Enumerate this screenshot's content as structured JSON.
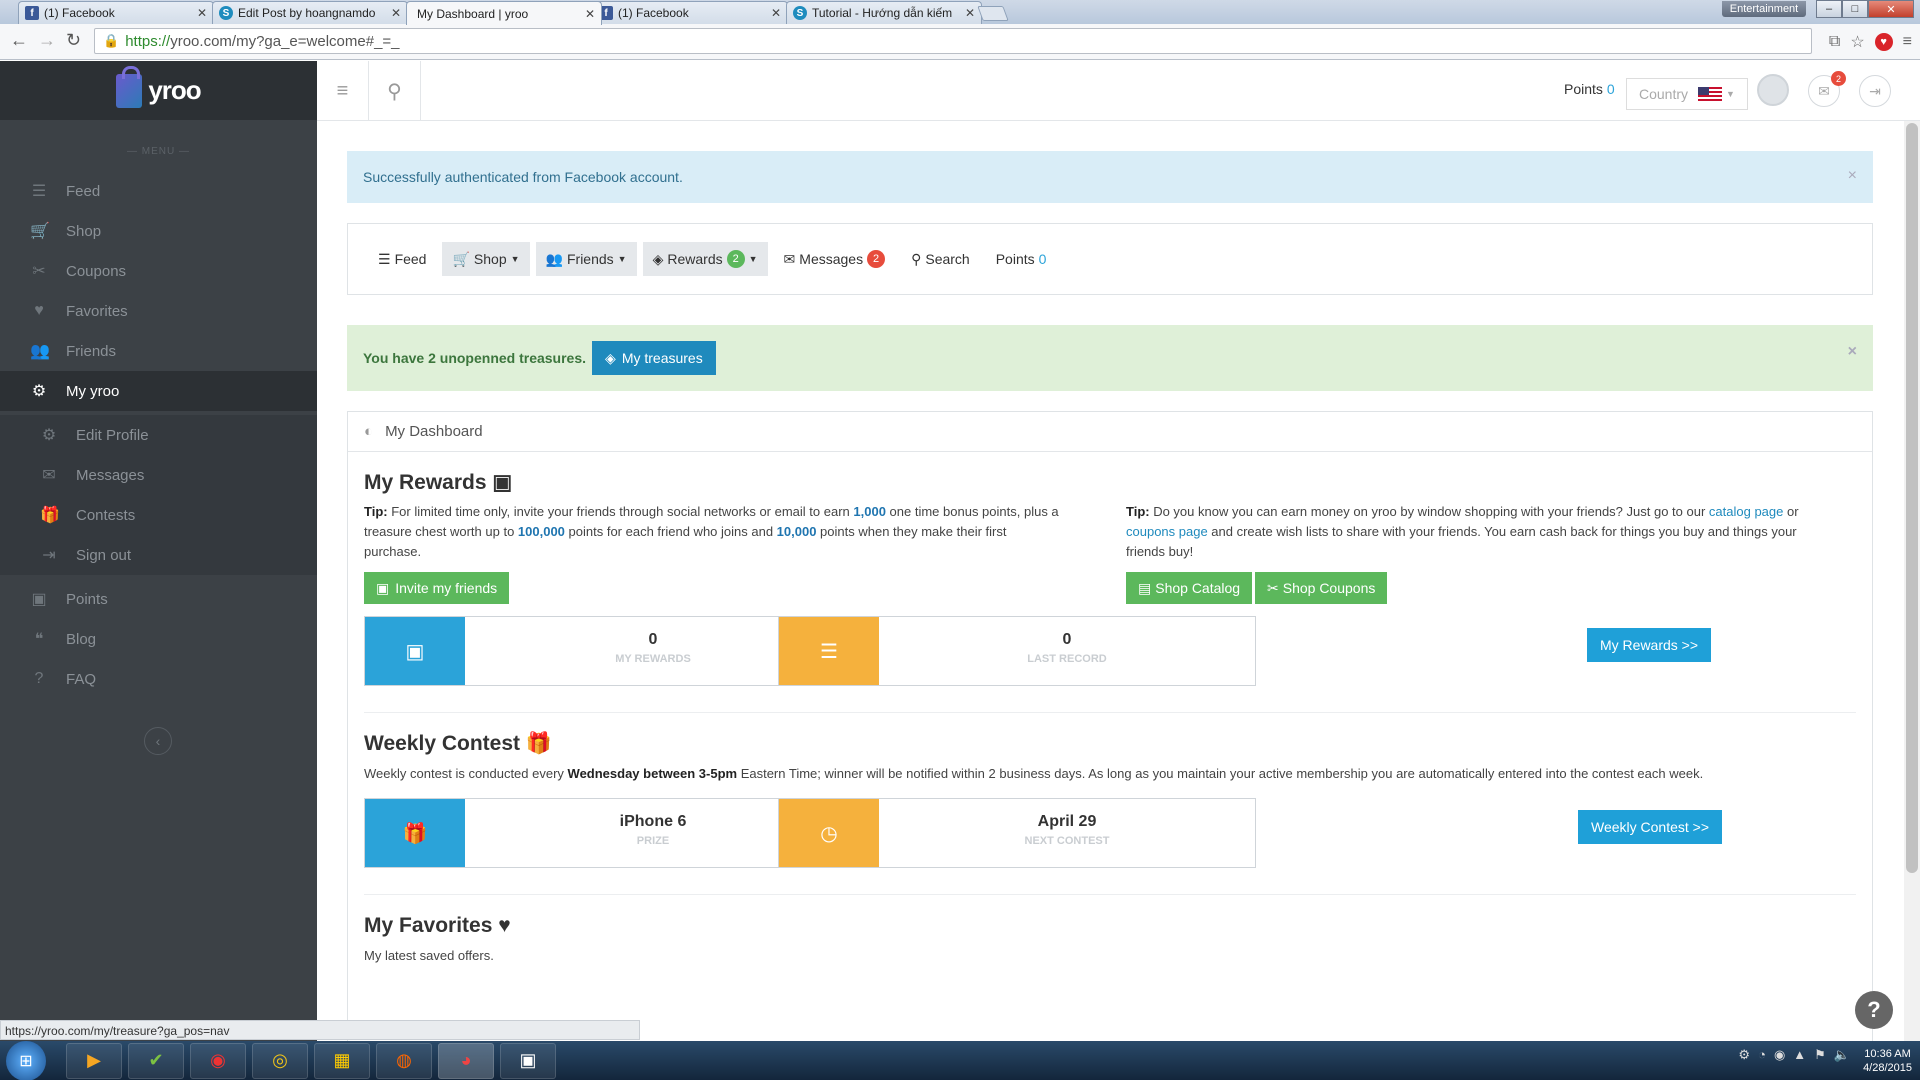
{
  "browser": {
    "tabs": [
      {
        "title": "(1) Facebook",
        "icon": "facebook-icon"
      },
      {
        "title": "Edit Post by hoangnamdo",
        "icon": "page-icon"
      },
      {
        "title": "My Dashboard | yroo",
        "icon": "none"
      },
      {
        "title": "(1) Facebook",
        "icon": "facebook-icon"
      },
      {
        "title": "Tutorial - Hướng dẫn kiếm",
        "icon": "page-icon"
      }
    ],
    "profile_badge": "Entertainment",
    "url_scheme": "https://",
    "url_rest": "yroo.com/my?ga_e=welcome#_=_",
    "status_url": "https://yroo.com/my/treasure?ga_pos=nav"
  },
  "sidebar": {
    "brand": "yroo",
    "menu_caption": "— MENU —",
    "items": [
      {
        "label": "Feed",
        "icon": "list-icon"
      },
      {
        "label": "Shop",
        "icon": "cart-icon"
      },
      {
        "label": "Coupons",
        "icon": "scissors-icon"
      },
      {
        "label": "Favorites",
        "icon": "heart-icon"
      },
      {
        "label": "Friends",
        "icon": "users-icon"
      },
      {
        "label": "My yroo",
        "icon": "gears-icon"
      }
    ],
    "sub_items": [
      {
        "label": "Edit Profile",
        "icon": "gears-icon"
      },
      {
        "label": "Messages",
        "icon": "envelope-icon"
      },
      {
        "label": "Contests",
        "icon": "gift-icon"
      },
      {
        "label": "Sign out",
        "icon": "signout-icon"
      }
    ],
    "bottom_items": [
      {
        "label": "Points",
        "icon": "money-icon"
      },
      {
        "label": "Blog",
        "icon": "quote-icon"
      },
      {
        "label": "FAQ",
        "icon": "question-icon"
      }
    ]
  },
  "appbar": {
    "points_label": "Points",
    "points_value": "0",
    "country_label": "Country",
    "notification_count": "2"
  },
  "alerts": {
    "info": "Successfully authenticated from Facebook account.",
    "success_prefix": "You have 2 unopenned treasures.",
    "treasure_button": "My treasures"
  },
  "subnav": {
    "feed": "Feed",
    "shop": "Shop",
    "friends": "Friends",
    "rewards": "Rewards",
    "rewards_badge": "2",
    "messages": "Messages",
    "messages_badge": "2",
    "search": "Search",
    "points": "Points",
    "points_value": "0"
  },
  "dashboard": {
    "title": "My Dashboard",
    "rewards": {
      "title": "My Rewards",
      "tip1_label": "Tip:",
      "tip1_a": " For limited time only, invite your friends through social networks or email to earn ",
      "tip1_n1": "1,000",
      "tip1_b": " one time bonus points, plus a treasure chest worth up to ",
      "tip1_n2": "100,000",
      "tip1_c": " points for each friend who joins and ",
      "tip1_n3": "10,000",
      "tip1_d": " points when they make their first purchase.",
      "tip2_label": "Tip:",
      "tip2_a": " Do you know you can earn money on yroo by window shopping with your friends? Just go to our ",
      "tip2_link1": "catalog page",
      "tip2_b": " or ",
      "tip2_link2": "coupons page",
      "tip2_c": " and create wish lists to share with your friends. You earn cash back for things you buy and things your friends buy!",
      "invite_button": "Invite my friends",
      "shop_catalog_button": "Shop Catalog",
      "shop_coupons_button": "Shop Coupons",
      "stat1_value": "0",
      "stat1_label": "MY REWARDS",
      "stat2_value": "0",
      "stat2_label": "LAST RECORD",
      "link_button": "My Rewards >>"
    },
    "contest": {
      "title": "Weekly Contest",
      "desc_a": "Weekly contest is conducted every ",
      "desc_bold": "Wednesday between 3-5pm",
      "desc_b": " Eastern Time; winner will be notified within 2 business days. As long as you maintain your active membership you are automatically entered into the contest each week.",
      "stat1_value": "iPhone 6",
      "stat1_label": "PRIZE",
      "stat2_value": "April 29",
      "stat2_label": "NEXT CONTEST",
      "link_button": "Weekly Contest >>"
    },
    "favorites": {
      "title": "My Favorites",
      "desc": "My latest saved offers."
    }
  },
  "taskbar": {
    "time": "10:36 AM",
    "date": "4/28/2015"
  },
  "colors": {
    "sidebar_bg": "#3c4146",
    "accent_blue": "#2ba3d9",
    "accent_yellow": "#f5b13d",
    "button_green": "#5cb85c",
    "badge_red": "#e74c3c"
  }
}
